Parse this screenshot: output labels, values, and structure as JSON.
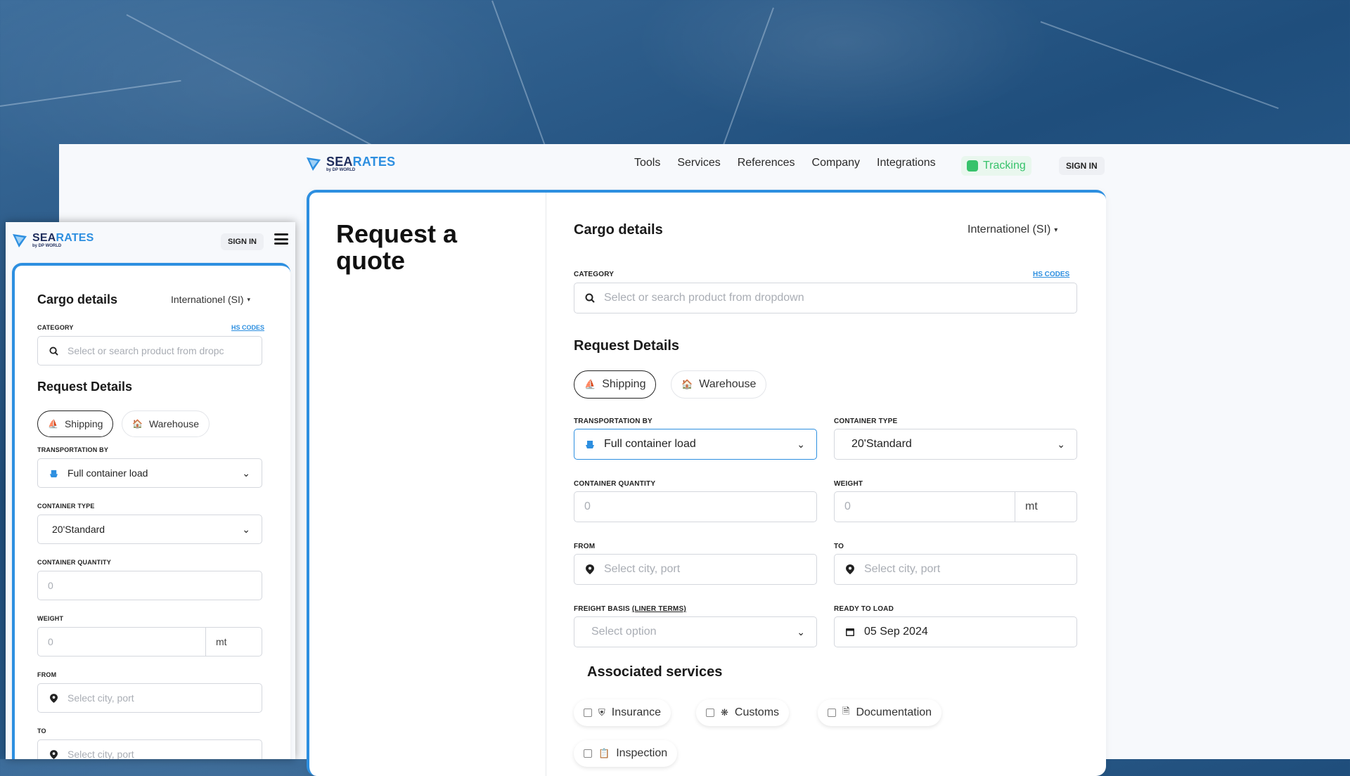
{
  "brand": {
    "name_a": "SEA",
    "name_b": "RATES",
    "sub": "by DP WORLD"
  },
  "colors": {
    "accent": "#2d8fe0",
    "tracking": "#37c26b"
  },
  "nav": {
    "links": [
      "Tools",
      "Services",
      "References",
      "Company",
      "Integrations"
    ],
    "tracking": "Tracking",
    "signin": "SIGN IN"
  },
  "page": {
    "title": "Request a quote"
  },
  "cargo": {
    "title": "Cargo details",
    "units": "Internationel (SI)",
    "category_label": "CATEGORY",
    "hs_codes": "HS CODES",
    "category_placeholder": "Select or search product from dropdown"
  },
  "request": {
    "title": "Request Details",
    "tabs": [
      "Shipping",
      "Warehouse"
    ],
    "transport_label": "TRANSPORTATION BY",
    "transport_value": "Full container load",
    "container_type_label": "CONTAINER TYPE",
    "container_type_value": "20'Standard",
    "quantity_label": "CONTAINER QUANTITY",
    "quantity_placeholder": "0",
    "weight_label": "WEIGHT",
    "weight_placeholder": "0",
    "weight_unit": "mt",
    "from_label": "FROM",
    "from_placeholder": "Select city, port",
    "to_label": "TO",
    "to_placeholder": "Select city, port",
    "freight_label": "FREIGHT BASIS",
    "freight_link": "(LINER TERMS)",
    "freight_placeholder": "Select option",
    "ready_label": "READY TO LOAD",
    "ready_value": "05 Sep 2024"
  },
  "services": {
    "title": "Associated services",
    "items": [
      "Insurance",
      "Customs",
      "Documentation",
      "Inspection"
    ]
  },
  "mobile": {
    "category_placeholder": "Select or search product from dropc"
  }
}
